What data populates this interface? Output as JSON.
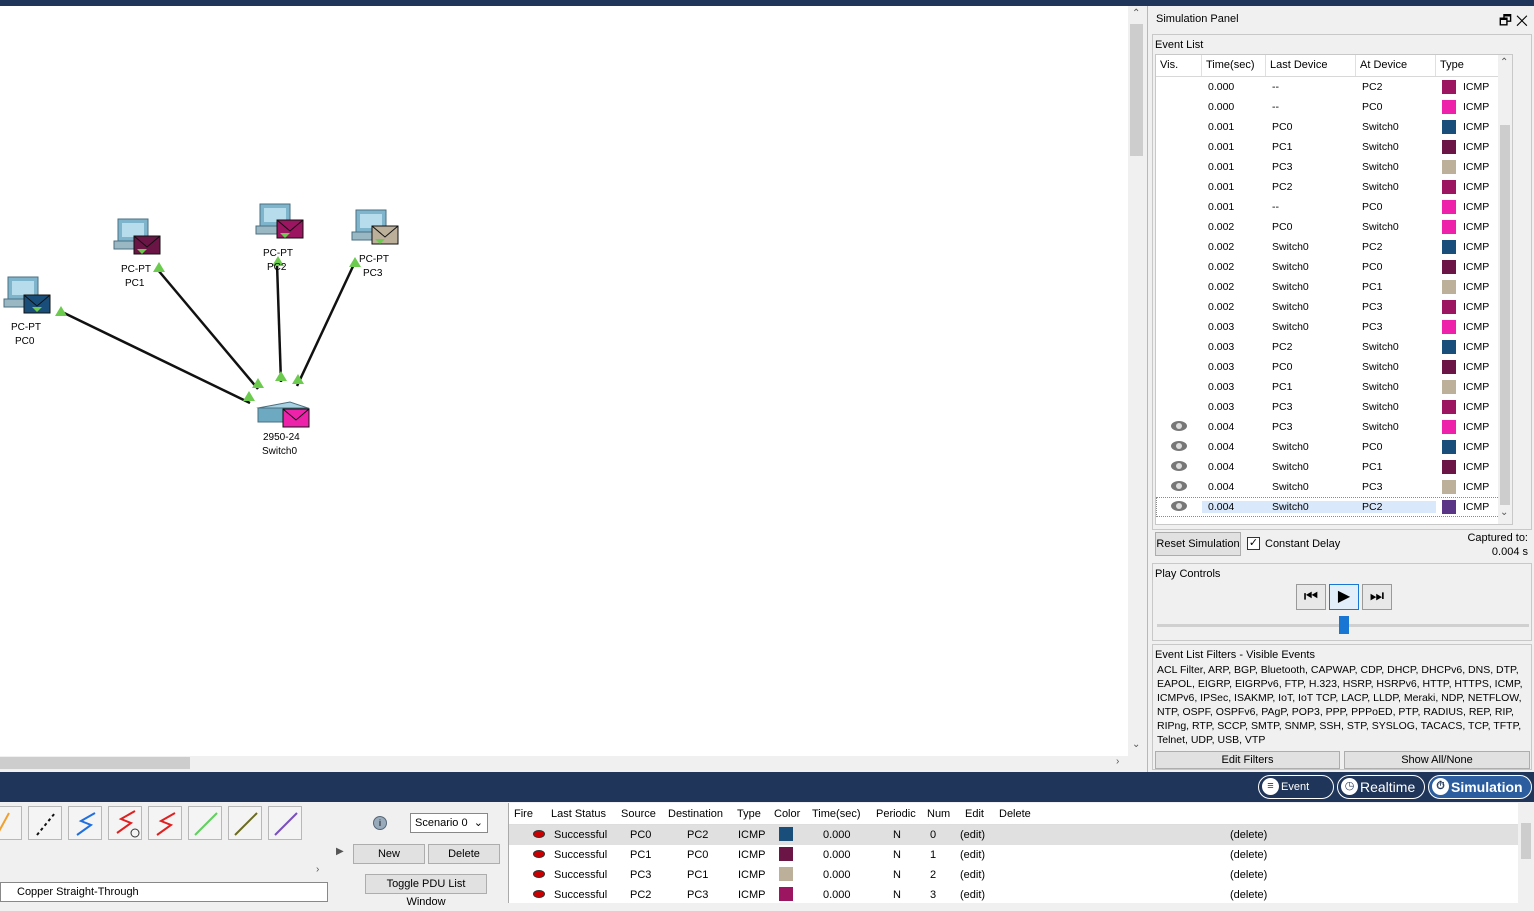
{
  "devices": [
    {
      "type": "PC-PT",
      "name": "PC0",
      "envelope": "#1a4e7a"
    },
    {
      "type": "PC-PT",
      "name": "PC1",
      "envelope": "#6b1546"
    },
    {
      "type": "PC-PT",
      "name": "PC2",
      "envelope": "#9b1560"
    },
    {
      "type": "PC-PT",
      "name": "PC3",
      "envelope": "#bcb09a"
    },
    {
      "type": "2950-24",
      "name": "Switch0",
      "envelope": "#ee22aa"
    }
  ],
  "panel": {
    "title": "Simulation Panel",
    "event_list_label": "Event List"
  },
  "event_columns": [
    "Vis.",
    "Time(sec)",
    "Last Device",
    "At Device",
    "Type"
  ],
  "events": [
    {
      "vis": false,
      "time": "0.000",
      "last": "--",
      "at": "PC2",
      "type": "ICMP",
      "color": "#9b1560"
    },
    {
      "vis": false,
      "time": "0.000",
      "last": "--",
      "at": "PC0",
      "type": "ICMP",
      "color": "#ee22aa"
    },
    {
      "vis": false,
      "time": "0.001",
      "last": "PC0",
      "at": "Switch0",
      "type": "ICMP",
      "color": "#1a4e7a"
    },
    {
      "vis": false,
      "time": "0.001",
      "last": "PC1",
      "at": "Switch0",
      "type": "ICMP",
      "color": "#6b1546"
    },
    {
      "vis": false,
      "time": "0.001",
      "last": "PC3",
      "at": "Switch0",
      "type": "ICMP",
      "color": "#bcb09a"
    },
    {
      "vis": false,
      "time": "0.001",
      "last": "PC2",
      "at": "Switch0",
      "type": "ICMP",
      "color": "#9b1560"
    },
    {
      "vis": false,
      "time": "0.001",
      "last": "--",
      "at": "PC0",
      "type": "ICMP",
      "color": "#ee22aa"
    },
    {
      "vis": false,
      "time": "0.002",
      "last": "PC0",
      "at": "Switch0",
      "type": "ICMP",
      "color": "#ee22aa"
    },
    {
      "vis": false,
      "time": "0.002",
      "last": "Switch0",
      "at": "PC2",
      "type": "ICMP",
      "color": "#1a4e7a"
    },
    {
      "vis": false,
      "time": "0.002",
      "last": "Switch0",
      "at": "PC0",
      "type": "ICMP",
      "color": "#6b1546"
    },
    {
      "vis": false,
      "time": "0.002",
      "last": "Switch0",
      "at": "PC1",
      "type": "ICMP",
      "color": "#bcb09a"
    },
    {
      "vis": false,
      "time": "0.002",
      "last": "Switch0",
      "at": "PC3",
      "type": "ICMP",
      "color": "#9b1560"
    },
    {
      "vis": false,
      "time": "0.003",
      "last": "Switch0",
      "at": "PC3",
      "type": "ICMP",
      "color": "#ee22aa"
    },
    {
      "vis": false,
      "time": "0.003",
      "last": "PC2",
      "at": "Switch0",
      "type": "ICMP",
      "color": "#1a4e7a"
    },
    {
      "vis": false,
      "time": "0.003",
      "last": "PC0",
      "at": "Switch0",
      "type": "ICMP",
      "color": "#6b1546"
    },
    {
      "vis": false,
      "time": "0.003",
      "last": "PC1",
      "at": "Switch0",
      "type": "ICMP",
      "color": "#bcb09a"
    },
    {
      "vis": false,
      "time": "0.003",
      "last": "PC3",
      "at": "Switch0",
      "type": "ICMP",
      "color": "#9b1560"
    },
    {
      "vis": true,
      "time": "0.004",
      "last": "PC3",
      "at": "Switch0",
      "type": "ICMP",
      "color": "#ee22aa"
    },
    {
      "vis": true,
      "time": "0.004",
      "last": "Switch0",
      "at": "PC0",
      "type": "ICMP",
      "color": "#1a4e7a"
    },
    {
      "vis": true,
      "time": "0.004",
      "last": "Switch0",
      "at": "PC1",
      "type": "ICMP",
      "color": "#6b1546"
    },
    {
      "vis": true,
      "time": "0.004",
      "last": "Switch0",
      "at": "PC3",
      "type": "ICMP",
      "color": "#bcb09a"
    },
    {
      "vis": true,
      "time": "0.004",
      "last": "Switch0",
      "at": "PC2",
      "type": "ICMP",
      "color": "#5a3585",
      "selected": true
    }
  ],
  "reset_label": "Reset Simulation",
  "constant_delay_label": "Constant Delay",
  "constant_delay_checked": true,
  "captured_label": "Captured to:",
  "captured_value": "0.004 s",
  "play_controls_label": "Play Controls",
  "filters": {
    "label": "Event List Filters - Visible Events",
    "text": "ACL Filter, ARP, BGP, Bluetooth, CAPWAP, CDP, DHCP, DHCPv6, DNS, DTP, EAPOL, EIGRP, EIGRPv6, FTP, H.323, HSRP, HSRPv6, HTTP, HTTPS, ICMP, ICMPv6, IPSec, ISAKMP, IoT, IoT TCP, LACP, LLDP, Meraki, NDP, NETFLOW, NTP, OSPF, OSPFv6, PAgP, POP3, PPP, PPPoED, PTP, RADIUS, REP, RIP, RIPng, RTP, SCCP, SMTP, SNMP, SSH, STP, SYSLOG, TACACS, TCP, TFTP, Telnet, UDP, USB, VTP",
    "edit_label": "Edit Filters",
    "show_label": "Show All/None"
  },
  "modes": {
    "event_list": "Event List",
    "realtime": "Realtime",
    "simulation": "Simulation"
  },
  "cable_label": "Copper Straight-Through",
  "scenario": {
    "value": "Scenario 0",
    "new_label": "New",
    "delete_label": "Delete",
    "toggle_label": "Toggle PDU List Window"
  },
  "pdu_columns": [
    "Fire",
    "Last Status",
    "Source",
    "Destination",
    "Type",
    "Color",
    "Time(sec)",
    "Periodic",
    "Num",
    "Edit",
    "Delete"
  ],
  "pdus": [
    {
      "status": "Successful",
      "source": "PC0",
      "dest": "PC2",
      "type": "ICMP",
      "color": "#1a4e7a",
      "time": "0.000",
      "periodic": "N",
      "num": "0",
      "edit": "(edit)",
      "delete": "(delete)"
    },
    {
      "status": "Successful",
      "source": "PC1",
      "dest": "PC0",
      "type": "ICMP",
      "color": "#6b1546",
      "time": "0.000",
      "periodic": "N",
      "num": "1",
      "edit": "(edit)",
      "delete": "(delete)"
    },
    {
      "status": "Successful",
      "source": "PC3",
      "dest": "PC1",
      "type": "ICMP",
      "color": "#bcb09a",
      "time": "0.000",
      "periodic": "N",
      "num": "2",
      "edit": "(edit)",
      "delete": "(delete)"
    },
    {
      "status": "Successful",
      "source": "PC2",
      "dest": "PC3",
      "type": "ICMP",
      "color": "#9b1560",
      "time": "0.000",
      "periodic": "N",
      "num": "3",
      "edit": "(edit)",
      "delete": "(delete)"
    }
  ]
}
